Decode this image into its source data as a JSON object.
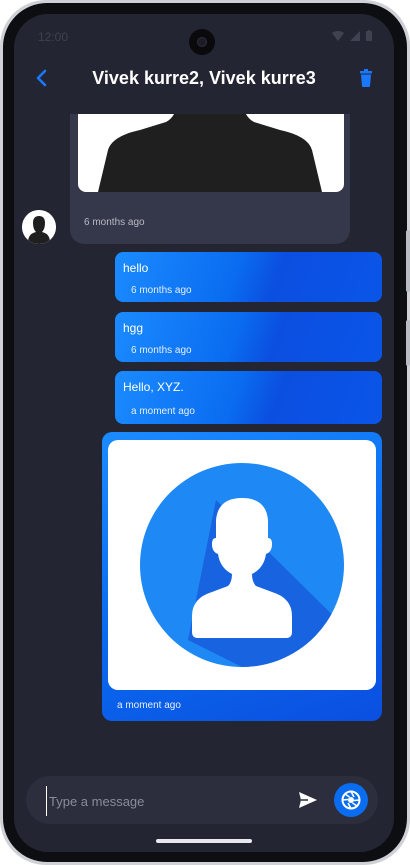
{
  "status_bar": {
    "time": "12:00"
  },
  "header": {
    "title": "Vivek kurre2, Vivek kurre3",
    "back_icon": "chevron-left-icon",
    "delete_icon": "trash-icon"
  },
  "messages": [
    {
      "type": "image",
      "direction": "received",
      "time": "6 months ago"
    },
    {
      "type": "text",
      "direction": "sent",
      "text": "hello",
      "time": "6 months ago"
    },
    {
      "type": "text",
      "direction": "sent",
      "text": "hgg",
      "time": "6 months ago"
    },
    {
      "type": "text",
      "direction": "sent",
      "text": "Hello, XYZ.",
      "time": "a moment ago"
    },
    {
      "type": "image",
      "direction": "sent",
      "time": "a moment ago"
    }
  ],
  "composer": {
    "placeholder": "Type a message",
    "send_icon": "send-icon",
    "camera_icon": "camera-shutter-icon"
  },
  "colors": {
    "background": "#232532",
    "accent": "#0a6cf0",
    "received_bubble": "#35374a"
  }
}
